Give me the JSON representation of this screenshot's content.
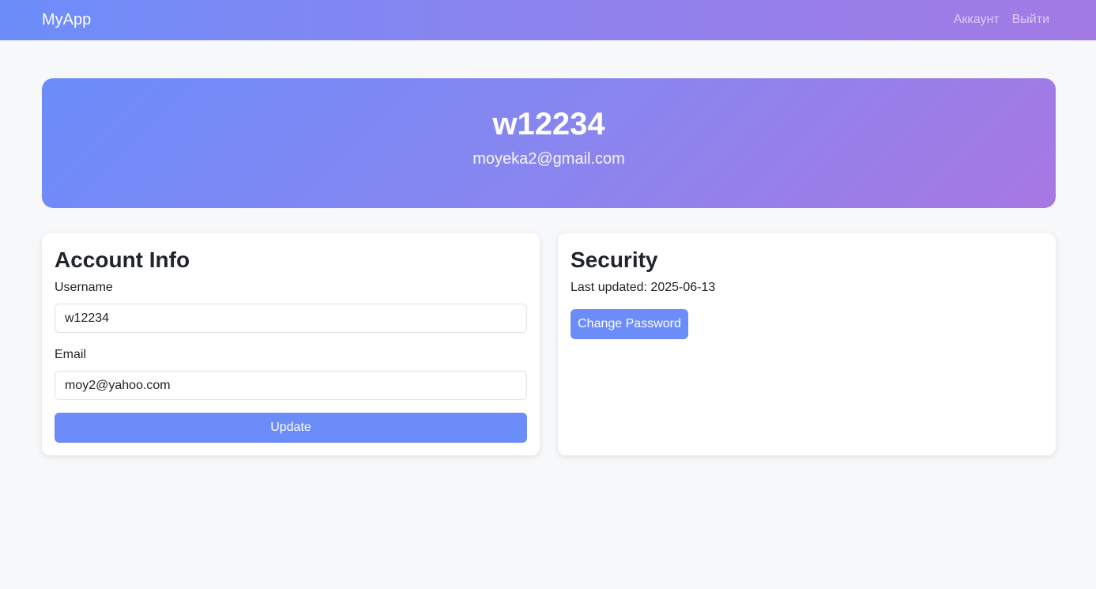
{
  "navbar": {
    "brand": "MyApp",
    "links": [
      "Аккаунт",
      "Выйти"
    ]
  },
  "hero": {
    "username": "w12234",
    "email": "moyeka2@gmail.com"
  },
  "account": {
    "title": "Account Info",
    "username_label": "Username",
    "username_value": "w12234",
    "email_label": "Email",
    "email_value": "moy2@yahoo.com",
    "update_label": "Update"
  },
  "security": {
    "title": "Security",
    "last_updated": "Last updated: 2025-06-13",
    "change_password_label": "Change Password"
  },
  "colors": {
    "accent": "#6c8df9",
    "gradient_start": "#6b8cfa",
    "gradient_end": "#a778e2",
    "background": "#f7f8fa"
  }
}
